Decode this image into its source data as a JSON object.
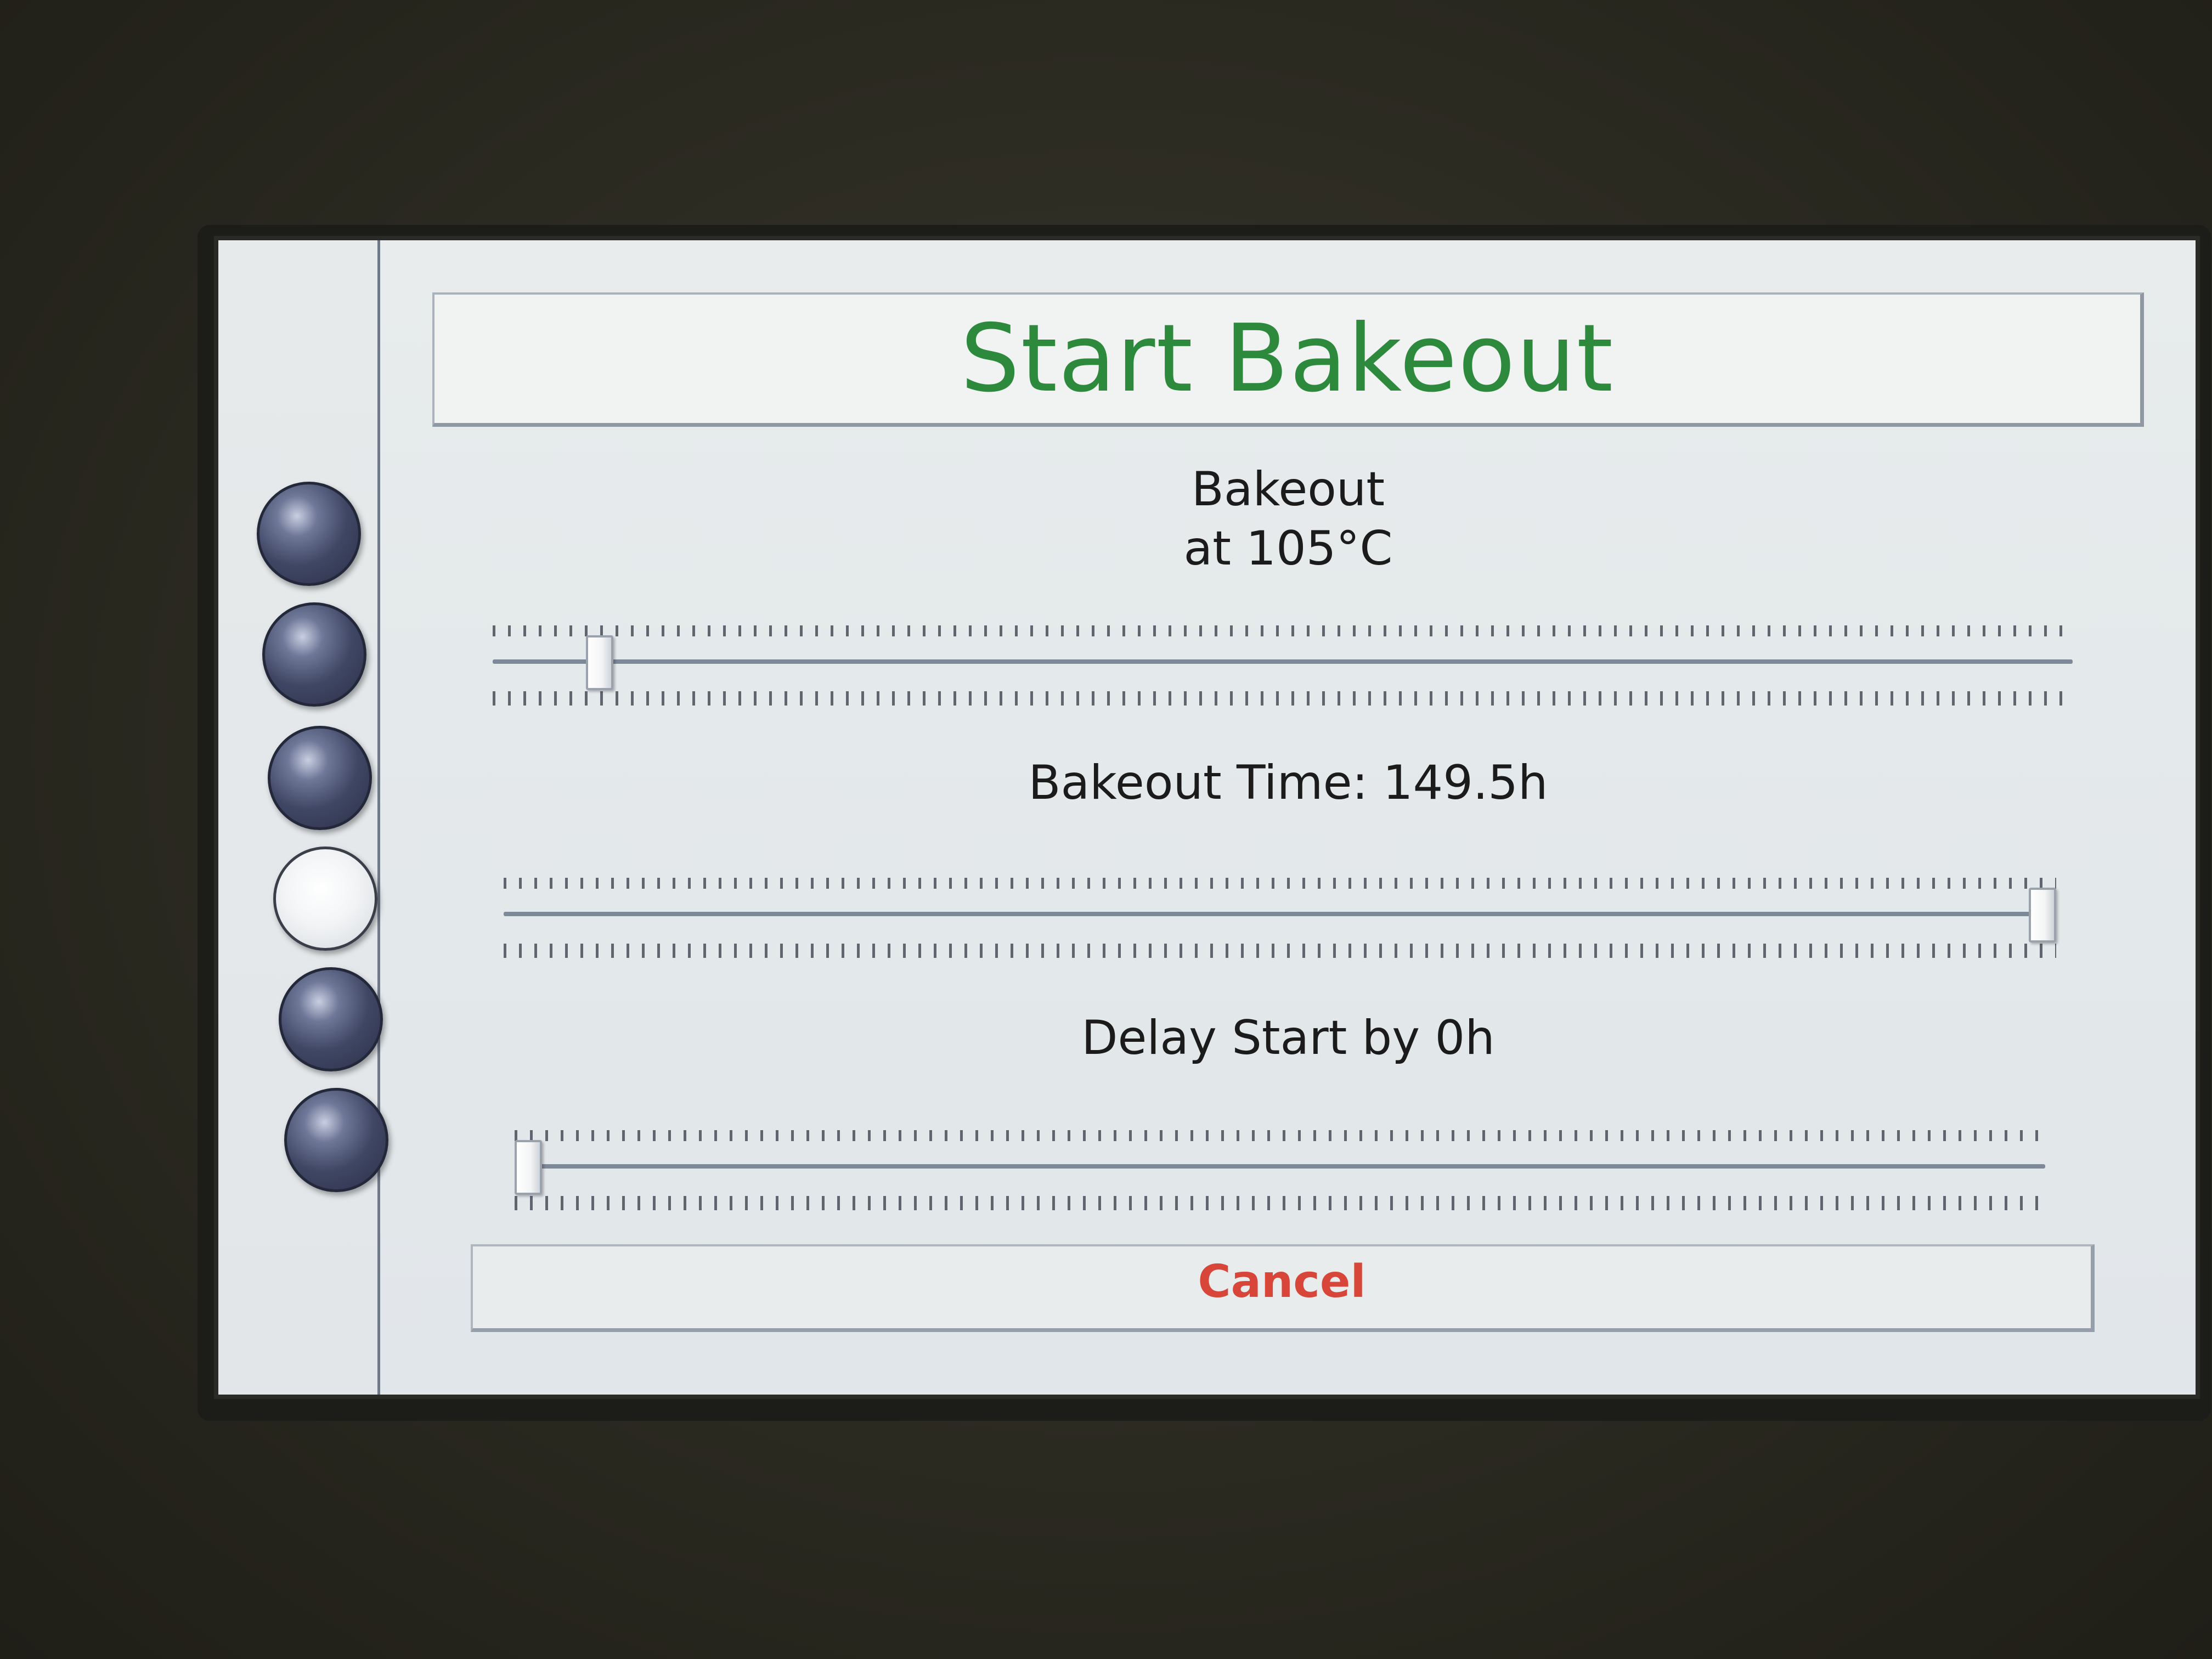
{
  "dialog": {
    "title": "Start Bakeout"
  },
  "sidebar": {
    "buttons": [
      {
        "state": "inactive"
      },
      {
        "state": "inactive"
      },
      {
        "state": "inactive"
      },
      {
        "state": "active"
      },
      {
        "state": "inactive"
      },
      {
        "state": "inactive"
      }
    ]
  },
  "bakeout_temp": {
    "line1": "Bakeout",
    "line2": "at 105°C",
    "slider_level": 0.06
  },
  "bakeout_time": {
    "label": "Bakeout Time: 149.5h",
    "slider_level": 1.0
  },
  "delay_start": {
    "label": "Delay Start by 0h",
    "slider_level": 0.0
  },
  "cancel": {
    "label": "Cancel"
  },
  "colors": {
    "title": "#2d8a3c",
    "cancel": "#d8463a",
    "screen_bg": "#e4e9eb"
  }
}
